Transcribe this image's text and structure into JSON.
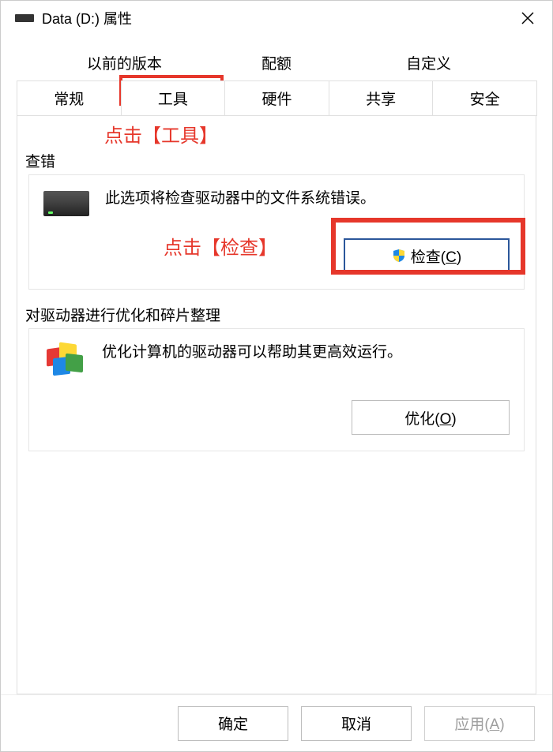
{
  "titlebar": {
    "title": "Data (D:) 属性"
  },
  "tabs": {
    "row1": [
      {
        "label": "以前的版本"
      },
      {
        "label": "配额"
      },
      {
        "label": "自定义"
      }
    ],
    "row2": [
      {
        "label": "常规"
      },
      {
        "label": "工具",
        "active": true
      },
      {
        "label": "硬件"
      },
      {
        "label": "共享"
      },
      {
        "label": "安全"
      }
    ]
  },
  "annotations": {
    "click_tools": "点击【工具】",
    "click_check": "点击【检查】"
  },
  "error_check": {
    "group_label": "查错",
    "description": "此选项将检查驱动器中的文件系统错误。",
    "button_prefix": "检查(",
    "button_hotkey": "C",
    "button_suffix": ")"
  },
  "optimize": {
    "group_label": "对驱动器进行优化和碎片整理",
    "description": "优化计算机的驱动器可以帮助其更高效运行。",
    "button_prefix": "优化(",
    "button_hotkey": "O",
    "button_suffix": ")"
  },
  "footer": {
    "ok": "确定",
    "cancel": "取消",
    "apply_prefix": "应用(",
    "apply_hotkey": "A",
    "apply_suffix": ")"
  }
}
